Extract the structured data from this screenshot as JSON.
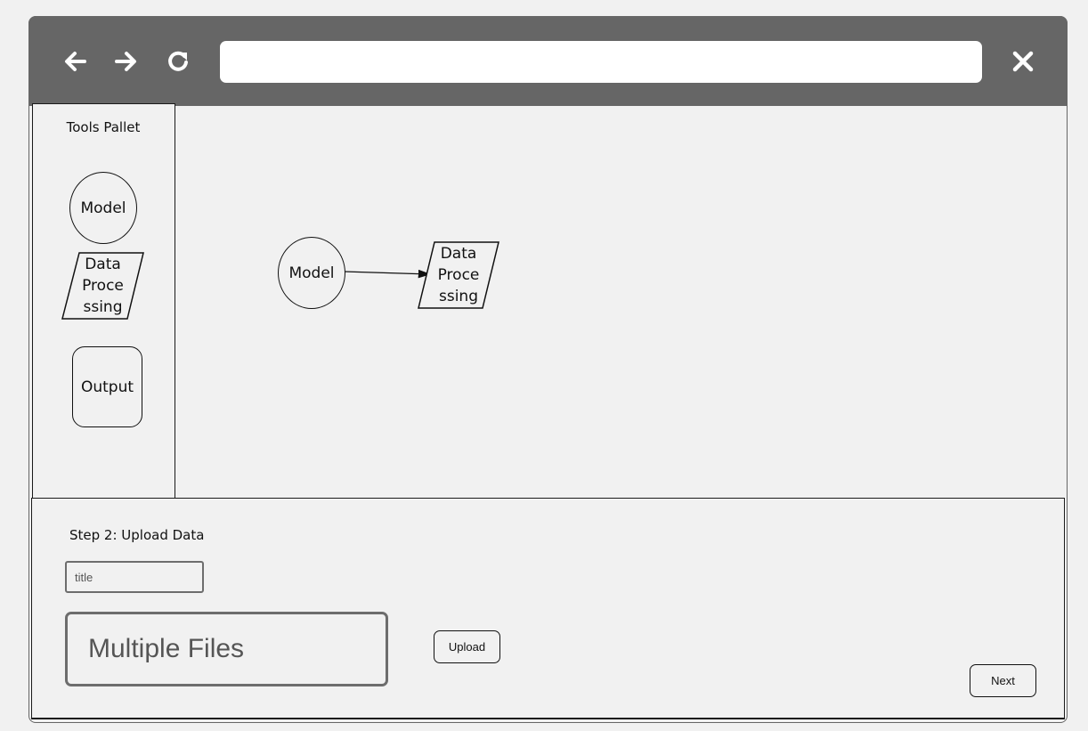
{
  "browser": {
    "back_icon": "arrow-left-icon",
    "forward_icon": "arrow-right-icon",
    "reload_icon": "reload-icon",
    "close_icon": "close-icon",
    "url_value": ""
  },
  "palette": {
    "title": "Tools Pallet",
    "items": [
      {
        "shape": "circle",
        "label": "Model"
      },
      {
        "shape": "parallelogram",
        "label": "Data\nProce\nssing"
      },
      {
        "shape": "rounded-rect",
        "label": "Output"
      }
    ]
  },
  "canvas": {
    "nodes": [
      {
        "shape": "circle",
        "label": "Model"
      },
      {
        "shape": "parallelogram",
        "label": "Data\nProce\nssing"
      }
    ],
    "edges": [
      {
        "from": "Model",
        "to": "Data Processing"
      }
    ]
  },
  "upload_panel": {
    "step_label": "Step 2: Upload Data",
    "title_placeholder": "title",
    "files_label": "Multiple Files",
    "upload_label": "Upload",
    "next_label": "Next"
  }
}
